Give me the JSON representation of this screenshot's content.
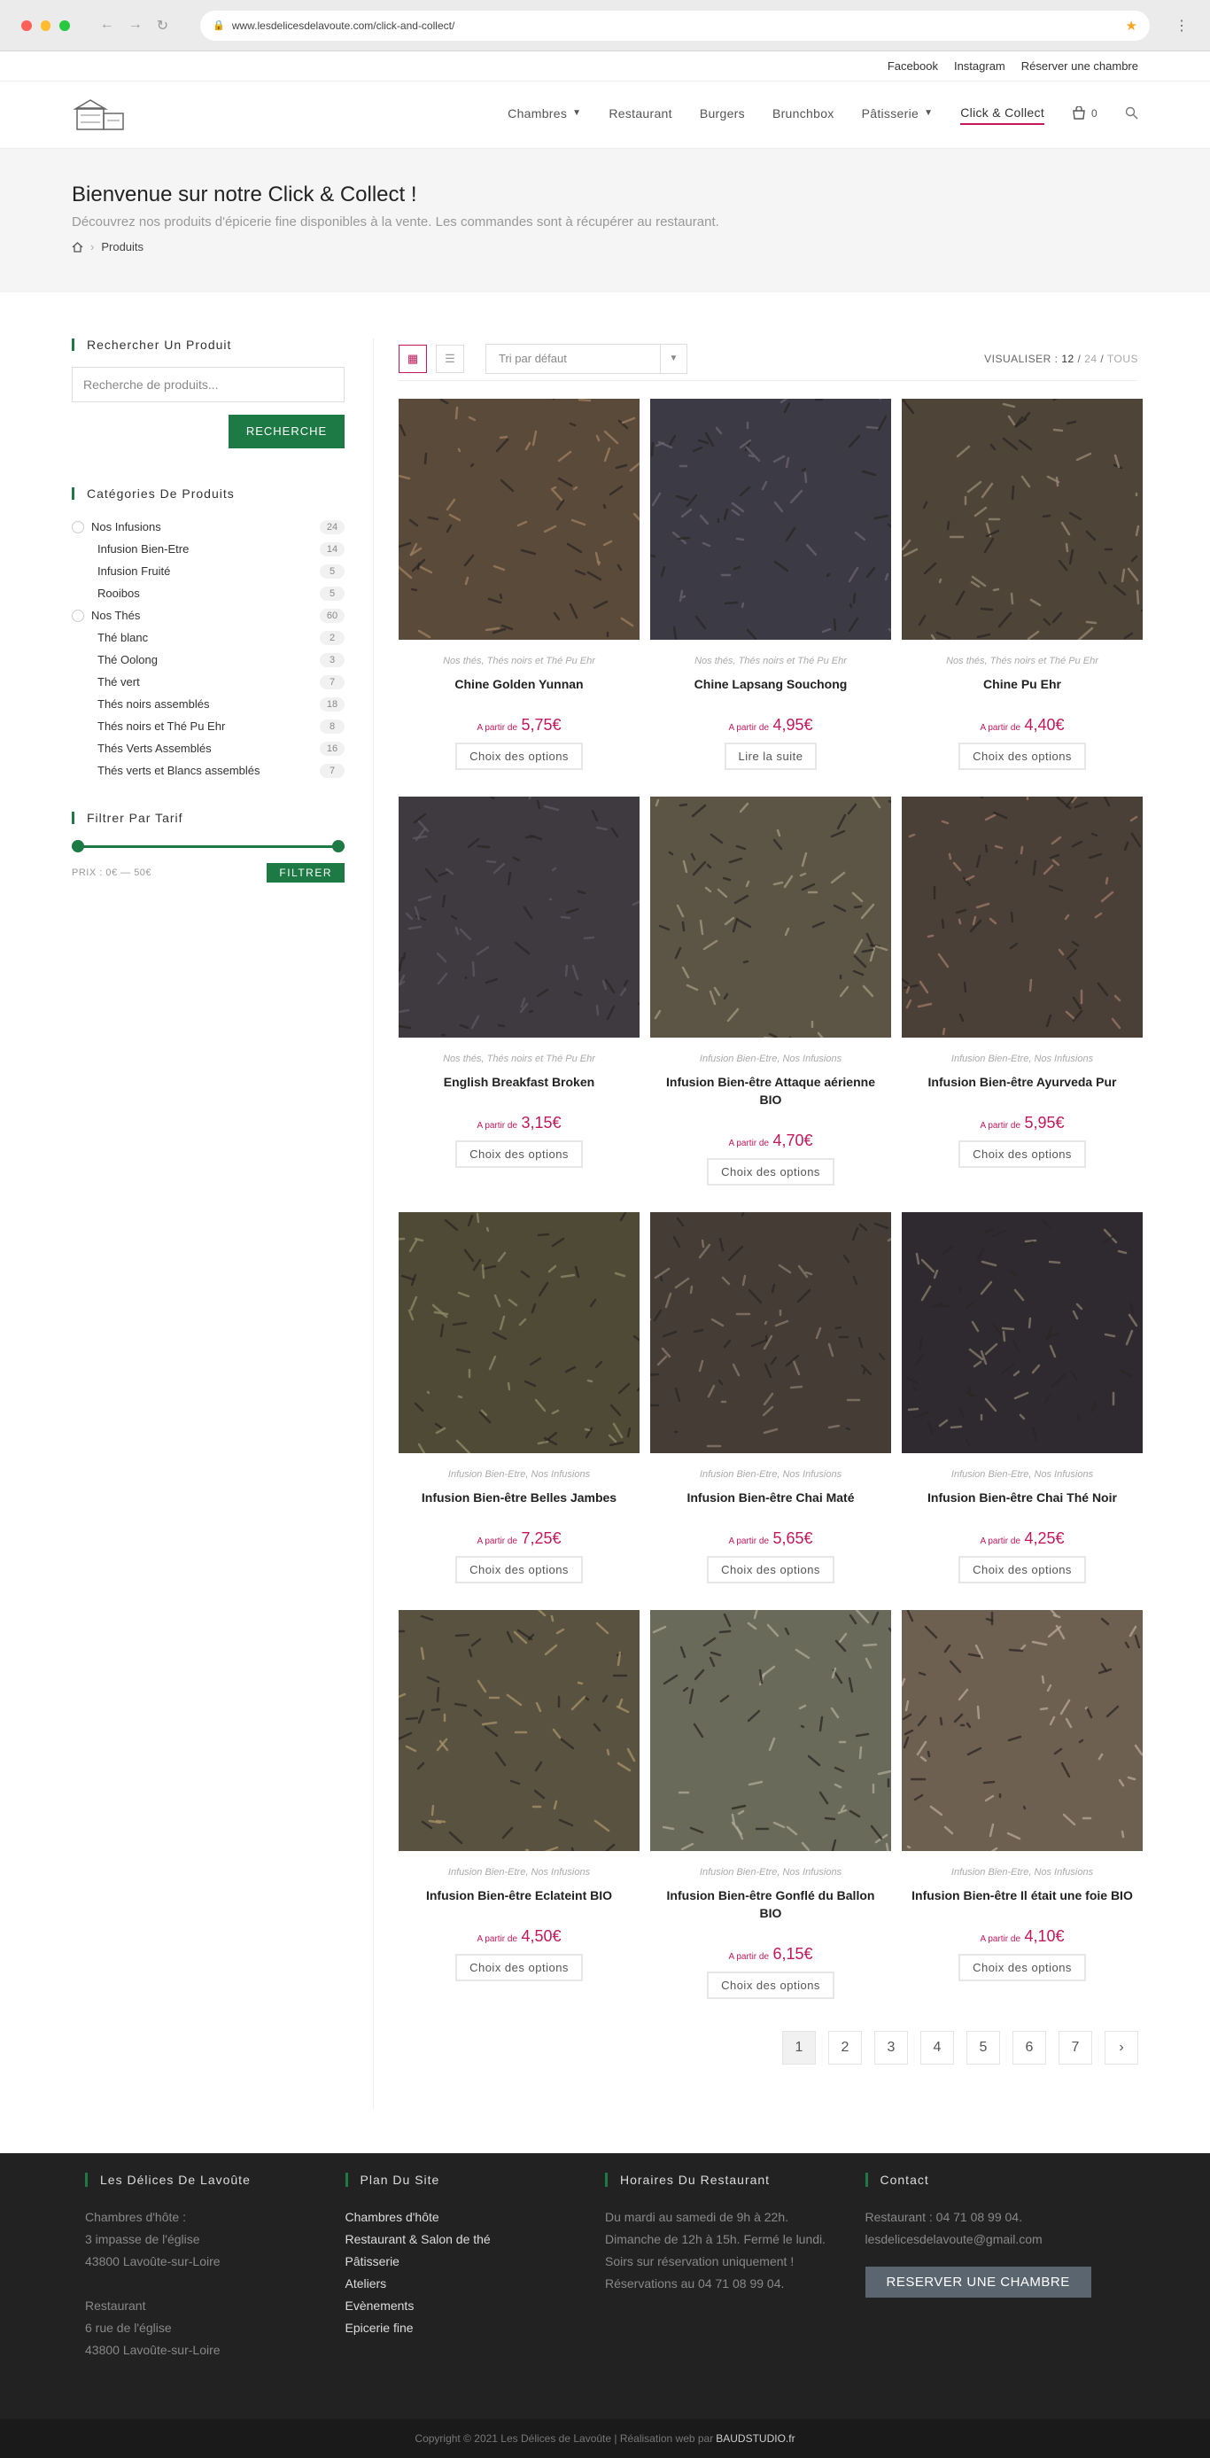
{
  "browser": {
    "url": "www.lesdelicesdelavoute.com/click-and-collect/"
  },
  "topbar": {
    "links": [
      "Facebook",
      "Instagram",
      "Réserver une chambre"
    ]
  },
  "nav": {
    "items": [
      "Chambres",
      "Restaurant",
      "Burgers",
      "Brunchbox",
      "Pâtisserie",
      "Click & Collect"
    ],
    "cart_count": "0"
  },
  "hero": {
    "title": "Bienvenue sur notre Click & Collect !",
    "subtitle": "Découvrez nos produits d'épicerie fine disponibles à la vente. Les commandes sont à récupérer au restaurant.",
    "breadcrumb": "Produits"
  },
  "sidebar": {
    "search_title": "Rechercher Un Produit",
    "search_placeholder": "Recherche de produits...",
    "search_button": "RECHERCHE",
    "cats_title": "Catégories De Produits",
    "categories": [
      {
        "label": "Nos Infusions",
        "count": "24",
        "sub": false
      },
      {
        "label": "Infusion Bien-Etre",
        "count": "14",
        "sub": true
      },
      {
        "label": "Infusion Fruité",
        "count": "5",
        "sub": true
      },
      {
        "label": "Rooibos",
        "count": "5",
        "sub": true
      },
      {
        "label": "Nos Thés",
        "count": "60",
        "sub": false
      },
      {
        "label": "Thé blanc",
        "count": "2",
        "sub": true
      },
      {
        "label": "Thé Oolong",
        "count": "3",
        "sub": true
      },
      {
        "label": "Thé vert",
        "count": "7",
        "sub": true
      },
      {
        "label": "Thés noirs assemblés",
        "count": "18",
        "sub": true
      },
      {
        "label": "Thés noirs et Thé Pu Ehr",
        "count": "8",
        "sub": true
      },
      {
        "label": "Thés Verts Assemblés",
        "count": "16",
        "sub": true
      },
      {
        "label": "Thés verts et Blancs assemblés",
        "count": "7",
        "sub": true
      }
    ],
    "price_title": "Filtrer Par Tarif",
    "price_label": "PRIX : 0€ — 50€",
    "filter_button": "FILTRER"
  },
  "toolbar": {
    "sort_label": "Tri par défaut",
    "show_label": "VISUALISER :",
    "show_current": "12",
    "show_24": "24",
    "show_all": "TOUS"
  },
  "products": [
    {
      "cats": "Nos thés, Thés noirs et Thé Pu Ehr",
      "name": "Chine Golden Yunnan",
      "apd": "A partir de",
      "price": "5,75€",
      "button": "Choix des options",
      "c1": "#5a4a3a",
      "c2": "#a08060"
    },
    {
      "cats": "Nos thés, Thés noirs et Thé Pu Ehr",
      "name": "Chine Lapsang Souchong",
      "apd": "A partir de",
      "price": "4,95€",
      "button": "Lire la suite",
      "c1": "#3c3a44",
      "c2": "#6a6470"
    },
    {
      "cats": "Nos thés, Thés noirs et Thé Pu Ehr",
      "name": "Chine Pu Ehr",
      "apd": "A partir de",
      "price": "4,40€",
      "button": "Choix des options",
      "c1": "#4e4438",
      "c2": "#9a8a74"
    },
    {
      "cats": "Nos thés, Thés noirs et Thé Pu Ehr",
      "name": "English Breakfast Broken",
      "apd": "A partir de",
      "price": "3,15€",
      "button": "Choix des options",
      "c1": "#3e3a40",
      "c2": "#5e5860"
    },
    {
      "cats": "Infusion Bien-Etre, Nos Infusions",
      "name": "Infusion Bien-être Attaque aérienne BIO",
      "apd": "A partir de",
      "price": "4,70€",
      "button": "Choix des options",
      "c1": "#5c5444",
      "c2": "#a69a80"
    },
    {
      "cats": "Infusion Bien-Etre, Nos Infusions",
      "name": "Infusion Bien-être Ayurveda Pur",
      "apd": "A partir de",
      "price": "5,95€",
      "button": "Choix des options",
      "c1": "#4a4038",
      "c2": "#a07a66"
    },
    {
      "cats": "Infusion Bien-Etre, Nos Infusions",
      "name": "Infusion Bien-être Belles Jambes",
      "apd": "A partir de",
      "price": "7,25€",
      "button": "Choix des options",
      "c1": "#4e4a36",
      "c2": "#8e8a68"
    },
    {
      "cats": "Infusion Bien-Etre, Nos Infusions",
      "name": "Infusion Bien-être Chai Maté",
      "apd": "A partir de",
      "price": "5,65€",
      "button": "Choix des options",
      "c1": "#463c36",
      "c2": "#8a7c6c"
    },
    {
      "cats": "Infusion Bien-Etre, Nos Infusions",
      "name": "Infusion Bien-être Chai Thé Noir",
      "apd": "A partir de",
      "price": "4,25€",
      "button": "Choix des options",
      "c1": "#2e2a30",
      "c2": "#8a806c"
    },
    {
      "cats": "Infusion Bien-Etre, Nos Infusions",
      "name": "Infusion Bien-être Eclateint BIO",
      "apd": "A partir de",
      "price": "4,50€",
      "button": "Choix des options",
      "c1": "#5a5240",
      "c2": "#a89468"
    },
    {
      "cats": "Infusion Bien-Etre, Nos Infusions",
      "name": "Infusion Bien-être Gonflé du Ballon BIO",
      "apd": "A partir de",
      "price": "6,15€",
      "button": "Choix des options",
      "c1": "#6a6a5a",
      "c2": "#b0aa98"
    },
    {
      "cats": "Infusion Bien-Etre, Nos Infusions",
      "name": "Infusion Bien-être Il était une foie BIO",
      "apd": "A partir de",
      "price": "4,10€",
      "button": "Choix des options",
      "c1": "#6e6050",
      "c2": "#b8a898"
    }
  ],
  "pagination": [
    "1",
    "2",
    "3",
    "4",
    "5",
    "6",
    "7"
  ],
  "footer": {
    "col1_title": "Les Délices De Lavoûte",
    "col1_lines": [
      "Chambres d'hôte :",
      "3 impasse de l'église",
      "43800 Lavoûte-sur-Loire",
      "",
      "Restaurant",
      "6 rue de l'église",
      "43800 Lavoûte-sur-Loire"
    ],
    "col2_title": "Plan Du Site",
    "col2_links": [
      "Chambres d'hôte",
      "Restaurant & Salon de thé",
      "Pâtisserie",
      "Ateliers",
      "Evènements",
      "Epicerie fine"
    ],
    "col3_title": "Horaires Du Restaurant",
    "col3_text": "Du mardi au samedi de 9h à 22h. Dimanche de 12h à 15h. Fermé le lundi. Soirs sur réservation uniquement ! Réservations au 04 71 08 99 04.",
    "col4_title": "Contact",
    "col4_lines": [
      "Restaurant : 04 71 08 99 04.",
      "lesdelicesdelavoute@gmail.com"
    ],
    "col4_button": "RESERVER UNE CHAMBRE",
    "copyright": "Copyright © 2021 Les Délices de Lavoûte | Réalisation web par",
    "brand": "BAUDSTUDIO.fr"
  }
}
